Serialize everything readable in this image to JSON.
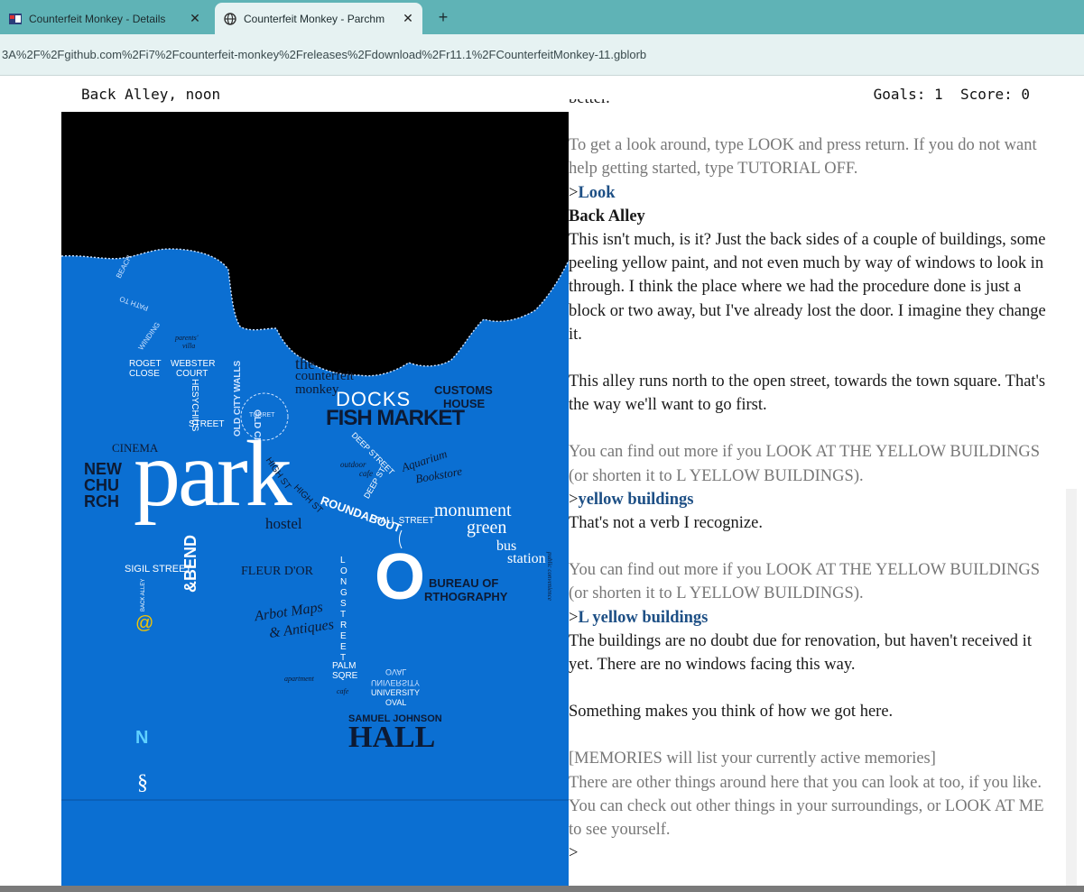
{
  "browser": {
    "tabs": [
      {
        "label": "Counterfeit Monkey - Details",
        "icon": "itch-favicon-icon",
        "active": false
      },
      {
        "label": "Counterfeit Monkey - Parchm",
        "icon": "globe-icon",
        "active": true
      }
    ],
    "close_glyph": "✕",
    "new_tab_glyph": "+",
    "url": "3A%2F%2Fgithub.com%2Fi7%2Fcounterfeit-monkey%2Freleases%2Fdownload%2Fr11.1%2FCounterfeitMonkey-11.gblorb"
  },
  "status": {
    "location": "Back Alley, noon",
    "goals_score": "Goals: 1  Score: 0"
  },
  "map": {
    "background_color": "#0b6fd2",
    "labels": {
      "beach": "BEACH",
      "path_to": "PATH TO",
      "winding": "WINDING",
      "parents_villa_1": "parents'",
      "parents_villa_2": "villa",
      "roget_1": "ROGET",
      "roget_2": "CLOSE",
      "webster_1": "WEBSTER",
      "webster_2": "COURT",
      "heschus": "HESYCHIUS",
      "street": "STREET",
      "old_city_walls_1": "OLD CITY WALLS",
      "old_city_walls_2": "OLD CITY WALLS",
      "the": "the",
      "counterfeit": "counterfeit",
      "monkey": "monkey",
      "docks": "DOCKS",
      "fish_market": "FISH MARKET",
      "customs_1": "CUSTOMS",
      "customs_2": "HOUSE",
      "turret": "TURRET",
      "deep_street": "DEEP STREET",
      "outdoor_cafe_1": "outdoor",
      "outdoor_cafe_2": "cafe",
      "aquarium_1": "Aquarium",
      "aquarium_2": "Bookstore",
      "cinema": "CINEMA",
      "new": "NEW",
      "chu": "CHU",
      "rch": "RCH",
      "park": "park",
      "high_st_1": "HIGH ST",
      "high_st_2": "HIGH ST",
      "deep_st": "DEEP ST",
      "roundabout": "ROUNDABOUT",
      "tall_street": "TALL STREET",
      "monument": "monument",
      "green": "green",
      "bus": "bus",
      "station": "station",
      "public_convenience": "public convenience",
      "hostel": "hostel",
      "bend": "&BEND",
      "sigil_street": "SIGIL STREET",
      "back_alley": "BACK ALLEY",
      "at": "@",
      "fleur": "FLEUR D'OR",
      "long_street": "LONG STREET",
      "o_big": "O",
      "bureau_1": "BUREAU OF",
      "bureau_2": "RTHOGRAPHY",
      "arbot_1": "Arbot Maps",
      "arbot_2": "& Antiques",
      "palm_1": "PALM",
      "palm_2": "SQRE",
      "apartment": "apartment",
      "cafe": "cafe",
      "oval_mirror": "OVAL",
      "univ_mirror": "UNIVERSITY",
      "univ": "UNIVERSITY",
      "oval": "OVAL",
      "samuel": "SAMUEL JOHNSON",
      "hall": "HALL",
      "north": "N",
      "section": "§"
    }
  },
  "transcript": {
    "cut_line": "better.",
    "hint1": "To get a look around, type LOOK and press return. If you do not want help getting started, type TUTORIAL OFF.",
    "cmd1_prompt": ">",
    "cmd1": "Look",
    "room_title": "Back Alley",
    "room_desc": "This isn't much, is it? Just the back sides of a couple of buildings, some peeling yellow paint, and not even much by way of windows to look in through. I think the place where we had the procedure done is just a block or two away, but I've already lost the door. I imagine they change it.",
    "room_desc2": "This alley runs north to the open street, towards the town square. That's the way we'll want to go first.",
    "hint2": "You can find out more if you LOOK AT THE YELLOW BUILDINGS (or shorten it to L YELLOW BUILDINGS).",
    "cmd2_prompt": ">",
    "cmd2": "yellow buildings",
    "resp2": "That's not a verb I recognize.",
    "hint3": "You can find out more if you LOOK AT THE YELLOW BUILDINGS (or shorten it to L YELLOW BUILDINGS).",
    "cmd3_prompt": ">",
    "cmd3": "L yellow buildings",
    "resp3": "The buildings are no doubt due for renovation, but haven't received it yet. There are no windows facing this way.",
    "resp4": "Something makes you think of how we got here.",
    "memories": "[MEMORIES will list your currently active memories]",
    "hint4": "There are other things around here that you can look at too, if you like. You can check out other things in your surroundings, or LOOK AT ME to see yourself.",
    "input_prompt": ">"
  }
}
